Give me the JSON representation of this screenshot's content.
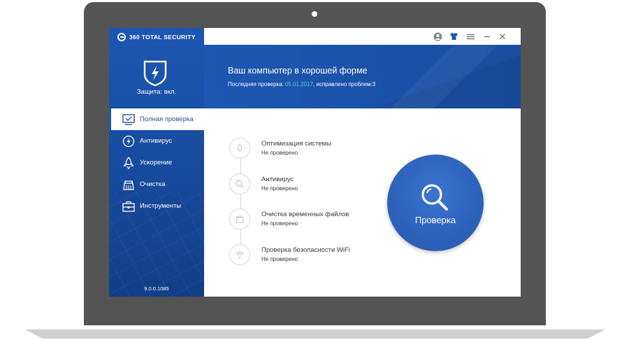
{
  "app": {
    "brand": "360 TOTAL SECURITY",
    "protection_status": "Защита: вкл.",
    "version": "9.0.0.1085"
  },
  "sidebar": {
    "items": [
      {
        "label": "Полная проверка",
        "icon": "monitor-check-icon",
        "active": true
      },
      {
        "label": "Антивирус",
        "icon": "lightning-circle-icon"
      },
      {
        "label": "Ускорение",
        "icon": "rocket-icon"
      },
      {
        "label": "Очистка",
        "icon": "broom-icon"
      },
      {
        "label": "Инструменты",
        "icon": "toolbox-icon"
      }
    ]
  },
  "titlebar": {
    "icons": [
      "user-icon",
      "shirt-icon",
      "menu-icon",
      "minimize-icon",
      "close-icon"
    ]
  },
  "banner": {
    "title": "Ваш компьютер в хорошей форме",
    "sub_prefix": "Последняя проверка: ",
    "sub_date": "05.01.2017",
    "sub_suffix": ", исправлено проблем:3"
  },
  "checks": [
    {
      "title": "Оптимизация системы",
      "status": "Не проверено",
      "icon": "bell-rocket-icon"
    },
    {
      "title": "Антивирус",
      "status": "Не проверено",
      "icon": "search-icon"
    },
    {
      "title": "Очистка временных файлов",
      "status": "Не проверено",
      "icon": "broom-icon"
    },
    {
      "title": "Проверка безопасности WiFi",
      "status": "Не проверено",
      "icon": "wifi-icon"
    }
  ],
  "scan_button": {
    "label": "Проверка",
    "icon": "magnifier-icon"
  },
  "colors": {
    "brand_blue": "#1d57b3",
    "accent_teal": "#58d5cf",
    "scan_blue": "#2d62bb",
    "bezel": "#545454"
  }
}
